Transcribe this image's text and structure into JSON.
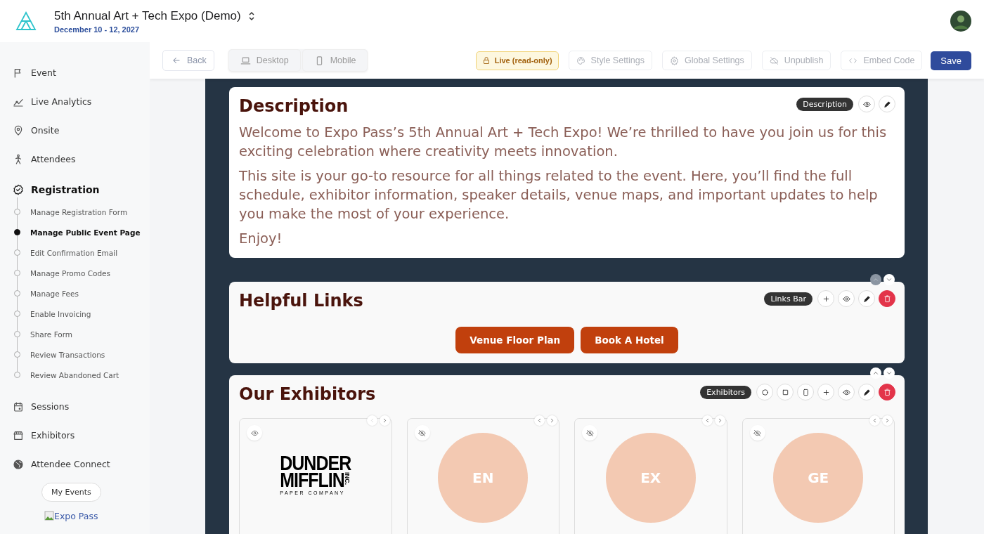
{
  "header": {
    "title": "5th Annual Art + Tech Expo (Demo)",
    "date": "December 10 - 12, 2027"
  },
  "sidebar": {
    "items": [
      {
        "label": "Event",
        "selected": false
      },
      {
        "label": "Live Analytics",
        "selected": false
      },
      {
        "label": "Onsite",
        "selected": false
      },
      {
        "label": "Attendees",
        "selected": false
      },
      {
        "label": "Registration",
        "selected": true,
        "children": [
          {
            "label": "Manage Registration Form",
            "selected": false
          },
          {
            "label": "Manage Public Event Page",
            "selected": true
          },
          {
            "label": "Edit Confirmation Email",
            "selected": false
          },
          {
            "label": "Manage Promo Codes",
            "selected": false
          },
          {
            "label": "Manage Fees",
            "selected": false
          },
          {
            "label": "Enable Invoicing",
            "selected": false
          },
          {
            "label": "Share Form",
            "selected": false
          },
          {
            "label": "Review Transactions",
            "selected": false
          },
          {
            "label": "Review Abandoned Cart",
            "selected": false
          }
        ]
      },
      {
        "label": "Sessions",
        "selected": false
      },
      {
        "label": "Exhibitors",
        "selected": false
      },
      {
        "label": "Attendee Connect",
        "selected": false
      }
    ],
    "my_events_button": "My Events",
    "brand_image_alt": "Expo Pass"
  },
  "toolbar": {
    "back": "Back",
    "views": [
      "Desktop",
      "Mobile"
    ],
    "status_badge": "Live (read-only)",
    "actions": [
      {
        "label": "Style Settings",
        "disabled": true
      },
      {
        "label": "Global Settings",
        "disabled": true
      },
      {
        "label": "Unpublish",
        "disabled": true
      },
      {
        "label": "Embed Code",
        "disabled": true
      }
    ],
    "save": "Save"
  },
  "sections": [
    {
      "kind": "text",
      "badge": "Description",
      "title": "Description",
      "paragraphs": [
        "Welcome to Expo Pass’s 5th Annual Art + Tech Expo! We’re thrilled to have you join us for this exciting celebration where creativity meets innovation.",
        "This site is your go-to resource for all things related to the event. Here, you’ll find the full schedule, exhibitor information, speaker details, venue maps, and important updates to help you make the most of your experience.",
        "Enjoy!"
      ]
    },
    {
      "kind": "links",
      "badge": "Links Bar",
      "title": "Helpful Links",
      "move_up_disabled": true,
      "links": [
        "Venue Floor Plan",
        "Book A Hotel"
      ]
    },
    {
      "kind": "exhibitors",
      "badge": "Exhibitors",
      "title": "Our Exhibitors",
      "move_up_disabled": false,
      "exhibitors": [
        {
          "kind": "logo",
          "hidden": false,
          "prev_disabled": true,
          "logo_lines": [
            "DUNDER",
            "MIFFLIN",
            "INC.",
            "PAPER COMPANY"
          ]
        },
        {
          "kind": "initials",
          "hidden": true,
          "prev_disabled": false,
          "initials": "EN"
        },
        {
          "kind": "initials",
          "hidden": true,
          "prev_disabled": false,
          "initials": "EX"
        },
        {
          "kind": "initials",
          "hidden": true,
          "prev_disabled": false,
          "initials": "GE"
        }
      ]
    }
  ]
}
